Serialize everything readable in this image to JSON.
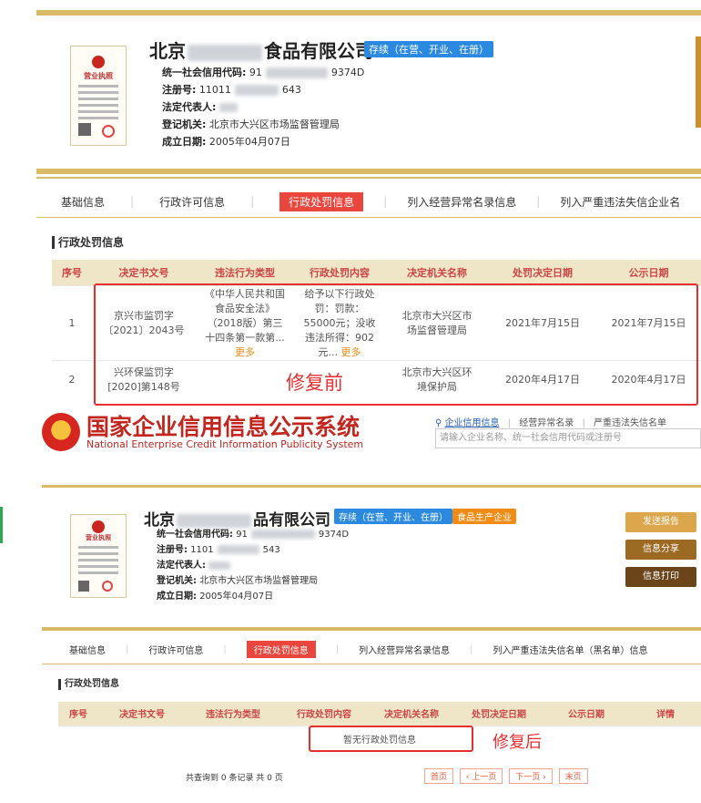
{
  "before": {
    "license": {
      "title": "营业执照"
    },
    "company": {
      "prefix": "北京",
      "suffix": "食品有限公司"
    },
    "status_badge": "存续（在营、开业、在册）",
    "info": [
      {
        "label": "统一社会信用代码:",
        "value_a": "91",
        "value_b": "9374D"
      },
      {
        "label": "注册号:",
        "value_a": "11011",
        "value_b": "643"
      },
      {
        "label": "法定代表人:",
        "value_a": "",
        "value_b": ""
      },
      {
        "label": "登记机关:",
        "value_a": "北京市大兴区市场监督管理局",
        "value_b": ""
      },
      {
        "label": "成立日期:",
        "value_a": "2005年04月07日",
        "value_b": ""
      }
    ],
    "tabs": [
      "基础信息",
      "行政许可信息",
      "行政处罚信息",
      "列入经营异常名录信息",
      "列入严重违法失信企业名"
    ],
    "active_tab": 2,
    "section_title": "行政处罚信息",
    "table_headers": [
      "序号",
      "决定书文号",
      "违法行为类型",
      "行政处罚内容",
      "决定机关名称",
      "处罚决定日期",
      "公示日期"
    ],
    "rows": [
      {
        "no": "1",
        "doc": "京兴市监罚字〔2021〕2043号",
        "type": "《中华人民共和国食品安全法》（2018版）第三十四条第一款第...",
        "content": "给予以下行政处罚：罚款：55000元；没收违法所得：902元...",
        "more": "更多",
        "authority": "北京市大兴区市场监督管理局",
        "decision_date": "2021年7月15日",
        "publish_date": "2021年7月15日"
      },
      {
        "no": "2",
        "doc": "兴环保监罚字[2020]第148号",
        "type": "",
        "content": "",
        "more": "",
        "authority": "北京市大兴区环境保护局",
        "decision_date": "2020年4月17日",
        "publish_date": "2020年4月17日"
      }
    ],
    "annotation": "修复前"
  },
  "header": {
    "title": "国家企业信用信息公示系统",
    "subtitle": "National Enterprise Credit Information Publicity System",
    "links": [
      "企业信用信息",
      "经营异常名录",
      "严重违法失信名单"
    ],
    "search_placeholder": "请输入企业名称、统一社会信用代码或注册号"
  },
  "after": {
    "license": {
      "title": "营业执照"
    },
    "company": {
      "prefix": "北京",
      "suffix": "品有限公司"
    },
    "status_badge": "存续（在营、开业、在册）",
    "food_badge": "食品生产企业",
    "info": [
      {
        "label": "统一社会信用代码:",
        "value_a": "91",
        "value_b": "9374D"
      },
      {
        "label": "注册号:",
        "value_a": "1101",
        "value_b": "543"
      },
      {
        "label": "法定代表人:",
        "value_a": "",
        "value_b": ""
      },
      {
        "label": "登记机关:",
        "value_a": "北京市大兴区市场监督管理局",
        "value_b": ""
      },
      {
        "label": "成立日期:",
        "value_a": "2005年04月07日",
        "value_b": ""
      }
    ],
    "buttons": [
      "发送报告",
      "信息分享",
      "信息打印"
    ],
    "tabs": [
      "基础信息",
      "行政许可信息",
      "行政处罚信息",
      "列入经营异常名录信息",
      "列入严重违法失信名单（黑名单）信息"
    ],
    "active_tab": 2,
    "section_title": "行政处罚信息",
    "table_headers": [
      "序号",
      "决定书文号",
      "违法行为类型",
      "行政处罚内容",
      "决定机关名称",
      "处罚决定日期",
      "公示日期",
      "详情"
    ],
    "empty_text": "暂无行政处罚信息",
    "annotation": "修复后",
    "pager_summary": "共查询到 0 条记录 共 0 页",
    "pager": [
      "首页",
      "‹ 上一页",
      "下一页 ›",
      "末页"
    ]
  }
}
